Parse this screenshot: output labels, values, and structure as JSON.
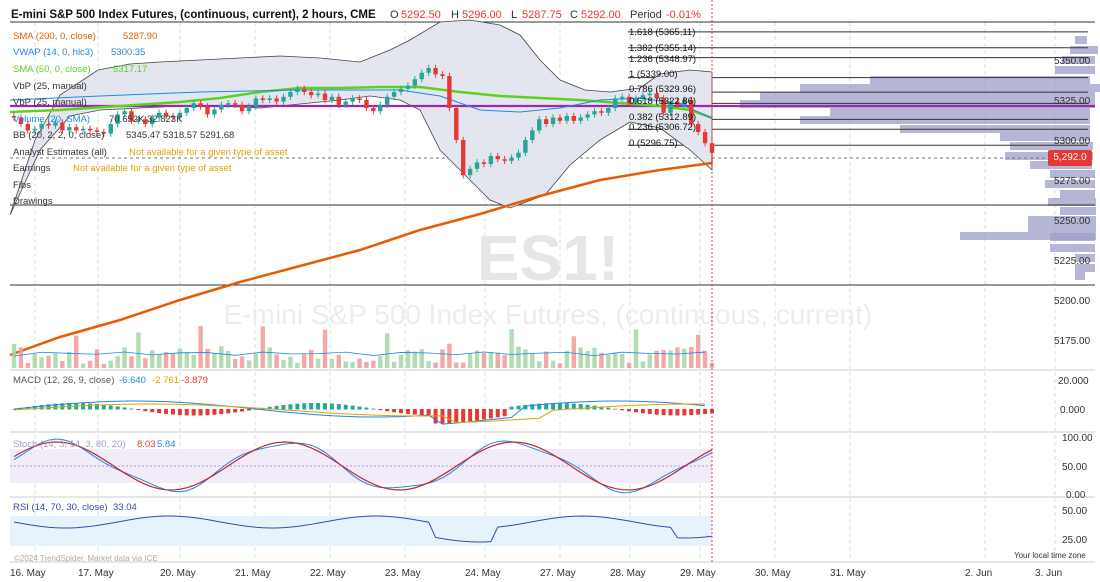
{
  "header": {
    "title": "E-mini S&P 500 Index Futures, (continuous, current), 2 hours, CME",
    "open_label": "O",
    "open_value": "5292.50",
    "high_label": "H",
    "high_value": "5296.00",
    "low_label": "L",
    "low_value": "5287.75",
    "close_label": "C",
    "close_value": "5292.00",
    "period_label": "Period",
    "period_value": "-0.01%"
  },
  "indicators": [
    {
      "label": "SMA (200, 0, close)",
      "value": "5287.90",
      "color": "#e65c00"
    },
    {
      "label": "VWAP (14, 0, hlc3)",
      "value": "5300.35",
      "color": "#1e88e5"
    },
    {
      "label": "SMA (50, 0, close)",
      "value": "5317.17",
      "color": "#5cd11f"
    },
    {
      "label": "VbP (25, manual)",
      "value": "",
      "color": "#333333"
    },
    {
      "label": "VbP (25, manual)",
      "value": "",
      "color": "#333333"
    },
    {
      "label": "Volume (20, SMA)",
      "value": "70.652K 32.823K",
      "color": "#1e88e5"
    },
    {
      "label": "BB (20, 2, 2, 0, close)",
      "value": "5345.47 5318.57 5291.68",
      "color": "#333333"
    },
    {
      "label": "Analyst Estimates (all)",
      "value": "Not available for a given type of asset",
      "color": "#333333"
    },
    {
      "label": "Earnings",
      "value": "Not available for a given type of asset",
      "color": "#333333"
    },
    {
      "label": "Fibs",
      "value": "",
      "color": "#333333"
    },
    {
      "label": "Drawings",
      "value": "",
      "color": "#333333"
    }
  ],
  "fib_labels": [
    "1.618 (5365.11)",
    "1.382 (5355.14)",
    "1.236 (5348.97)",
    "1 (5339.00)",
    "0.786 (5329.96)",
    "0.618 (5322.86)",
    "0.382 (5312.89)",
    "0.236 (5306.72)",
    "0 (5296.75)"
  ],
  "last_price_tag": "5,292.0",
  "watermark": {
    "symbol": "ES1!",
    "name": "E-mini S&P 500 Index Futures, (continuous, current)"
  },
  "macd": {
    "label": "MACD (12, 26, 9, close)",
    "v1": "-6.640",
    "v2": "-2.761",
    "v3": "-3.879"
  },
  "stoch": {
    "label": "Stoch (14, 3, 14, 3, 80, 20)",
    "v1": "8.03",
    "v2": "5.84"
  },
  "rsi": {
    "label": "RSI (14, 70, 30, close)",
    "value": "33.04"
  },
  "credits": "©2024 TrendSpider. Market data via ICE",
  "local_time_label": "Your local time zone",
  "colors": {
    "up": "#26a69a",
    "down": "#e53935",
    "sma200": "#e65c00",
    "sma50": "#5cd11f",
    "vbp": "#9e9ec8",
    "purple": "#9c27b0",
    "bb_fill": "#e3e6ee"
  },
  "chart_data": [
    {
      "type": "candlestick",
      "title": "E-mini S&P 500 Index Futures, (continuous, current), 2 hours, CME",
      "x_tick_labels": [
        "16. May",
        "17. May",
        "20. May",
        "21. May",
        "22. May",
        "23. May",
        "24. May",
        "27. May",
        "28. May",
        "29. May",
        "30. May",
        "31. May",
        "2. Jun",
        "3. Jun"
      ],
      "y_tick_labels": [
        "5350.00",
        "5325.00",
        "5300.00",
        "5275.00",
        "5250.00",
        "5225.00",
        "5200.00",
        "5175.00"
      ],
      "ylim": [
        5160,
        5370
      ],
      "close_series": [
        5314,
        5310,
        5306,
        5307,
        5310,
        5309,
        5311,
        5306,
        5308,
        5306,
        5307,
        5306,
        5305,
        5304,
        5310,
        5316,
        5318,
        5312,
        5313,
        5310,
        5314,
        5317,
        5315,
        5314,
        5317,
        5320,
        5323,
        5321,
        5316,
        5319,
        5322,
        5323,
        5322,
        5318,
        5321,
        5326,
        5325,
        5326,
        5324,
        5327,
        5330,
        5332,
        5330,
        5328,
        5329,
        5325,
        5327,
        5322,
        5324,
        5326,
        5325,
        5320,
        5318,
        5322,
        5327,
        5330,
        5332,
        5334,
        5338,
        5342,
        5345,
        5341,
        5340,
        5320,
        5300,
        5278,
        5282,
        5286,
        5285,
        5290,
        5288,
        5287,
        5289,
        5292,
        5300,
        5306,
        5313,
        5310,
        5314,
        5312,
        5315,
        5312,
        5314,
        5316,
        5318,
        5317,
        5320,
        5326,
        5327,
        5323,
        5326,
        5328,
        5329,
        5326,
        5317,
        5324,
        5322,
        5325,
        5310,
        5305,
        5298,
        5292
      ],
      "sma200_endpoints": [
        5169,
        5290
      ],
      "sma50_range": [
        5302,
        5330
      ],
      "fib_levels": [
        5365.11,
        5355.14,
        5348.97,
        5339.0,
        5329.96,
        5322.86,
        5312.89,
        5306.72,
        5296.75
      ],
      "last_price": 5292.0,
      "volume_sma_label": "70.652K 32.823K"
    },
    {
      "type": "line",
      "title": "MACD (12, 26, 9, close)",
      "y_tick_labels": [
        "20.000",
        "0.000"
      ],
      "last_values": [
        -6.64,
        -2.761,
        -3.879
      ]
    },
    {
      "type": "line",
      "title": "Stoch (14, 3, 14, 3, 80, 20)",
      "y_tick_labels": [
        "100.00",
        "50.00",
        "0.00"
      ],
      "last_values": [
        8.03,
        5.84
      ]
    },
    {
      "type": "line",
      "title": "RSI (14, 70, 30, close)",
      "y_tick_labels": [
        "50.00",
        "25.00"
      ],
      "last_values": [
        33.04
      ]
    }
  ]
}
